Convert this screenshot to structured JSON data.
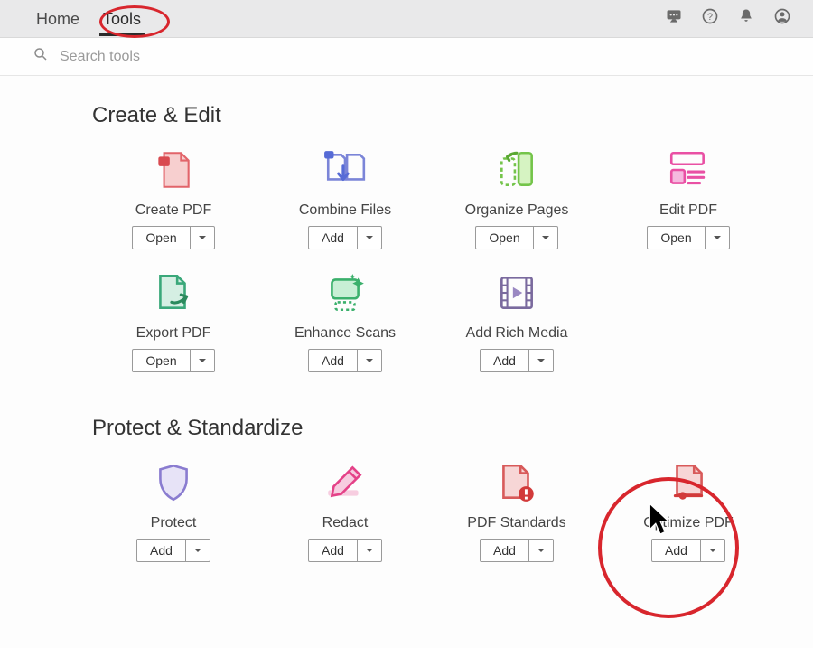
{
  "topbar": {
    "tabs": [
      {
        "label": "Home",
        "active": false
      },
      {
        "label": "Tools",
        "active": true
      }
    ]
  },
  "search": {
    "placeholder": "Search tools"
  },
  "sections": {
    "create_edit": {
      "title": "Create & Edit",
      "tools": [
        {
          "label": "Create PDF",
          "action": "Open"
        },
        {
          "label": "Combine Files",
          "action": "Add"
        },
        {
          "label": "Organize Pages",
          "action": "Open"
        },
        {
          "label": "Edit PDF",
          "action": "Open"
        },
        {
          "label": "Export PDF",
          "action": "Open"
        },
        {
          "label": "Enhance Scans",
          "action": "Add"
        },
        {
          "label": "Add Rich Media",
          "action": "Add"
        }
      ]
    },
    "protect_std": {
      "title": "Protect & Standardize",
      "tools": [
        {
          "label": "Protect",
          "action": "Add"
        },
        {
          "label": "Redact",
          "action": "Add"
        },
        {
          "label": "PDF Standards",
          "action": "Add"
        },
        {
          "label": "Optimize PDF",
          "action": "Add"
        }
      ]
    }
  }
}
